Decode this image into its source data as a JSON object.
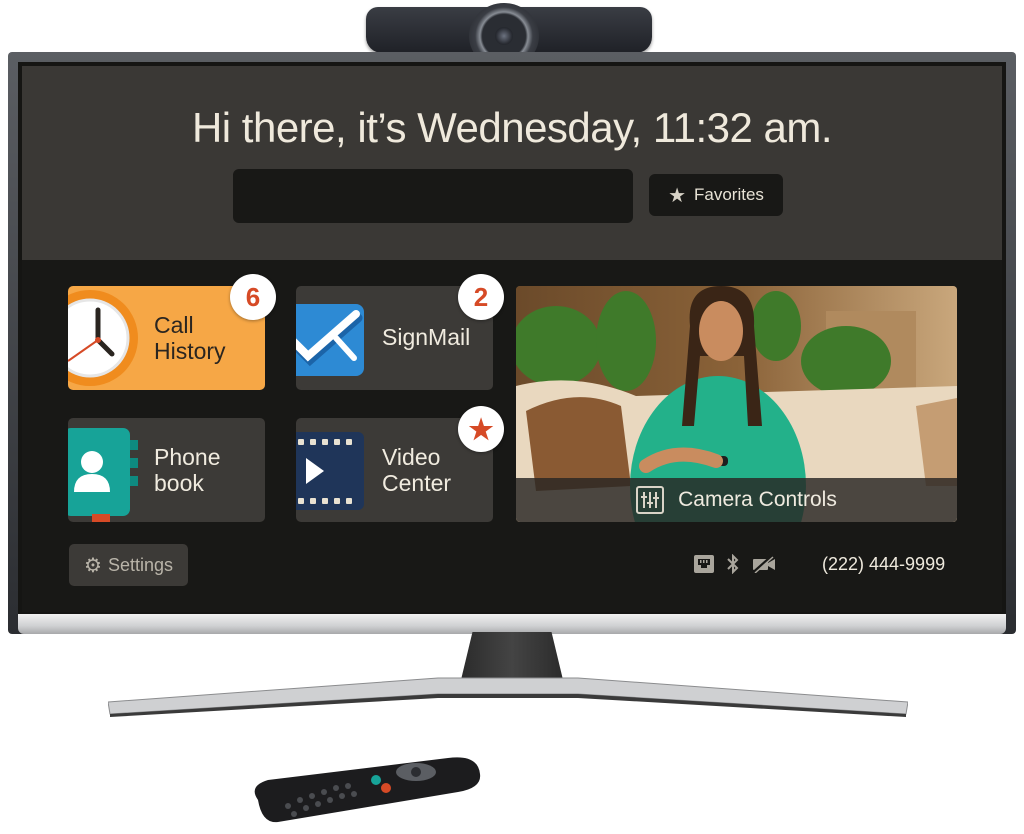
{
  "header": {
    "greeting": "Hi there, it’s Wednesday, 11:32 am.",
    "search": {
      "value": "",
      "placeholder": ""
    },
    "favorites_label": "Favorites",
    "favorites_icon": "star-icon"
  },
  "tiles": [
    {
      "id": "call-history",
      "label_line1": "Call",
      "label_line2": "History",
      "icon": "clock-icon",
      "badge": "6",
      "color": "#f6a746"
    },
    {
      "id": "signmail",
      "label_line1": "SignMail",
      "label_line2": "",
      "icon": "signmail-icon",
      "badge": "2",
      "color": "#2d8ad4"
    },
    {
      "id": "phonebook",
      "label_line1": "Phone",
      "label_line2": "book",
      "icon": "phonebook-icon",
      "badge": "",
      "color": "#17a398"
    },
    {
      "id": "video-center",
      "label_line1": "Video",
      "label_line2": "Center",
      "icon": "film-icon",
      "badge": "star",
      "color": "#1f3559"
    }
  ],
  "video_preview": {
    "camera_controls_label": "Camera Controls",
    "camera_controls_icon": "sliders-icon"
  },
  "footer": {
    "settings_label": "Settings",
    "settings_icon": "gear-icon",
    "status_icons": [
      "ethernet-icon",
      "bluetooth-icon",
      "video-off-icon"
    ],
    "phone_number": "(222) 444-9999"
  },
  "colors": {
    "accent_orange": "#f6a746",
    "badge_red": "#d64a26",
    "screen_bg": "#181816",
    "header_bg": "#3a3835",
    "tile_bg": "#3c3a37"
  }
}
